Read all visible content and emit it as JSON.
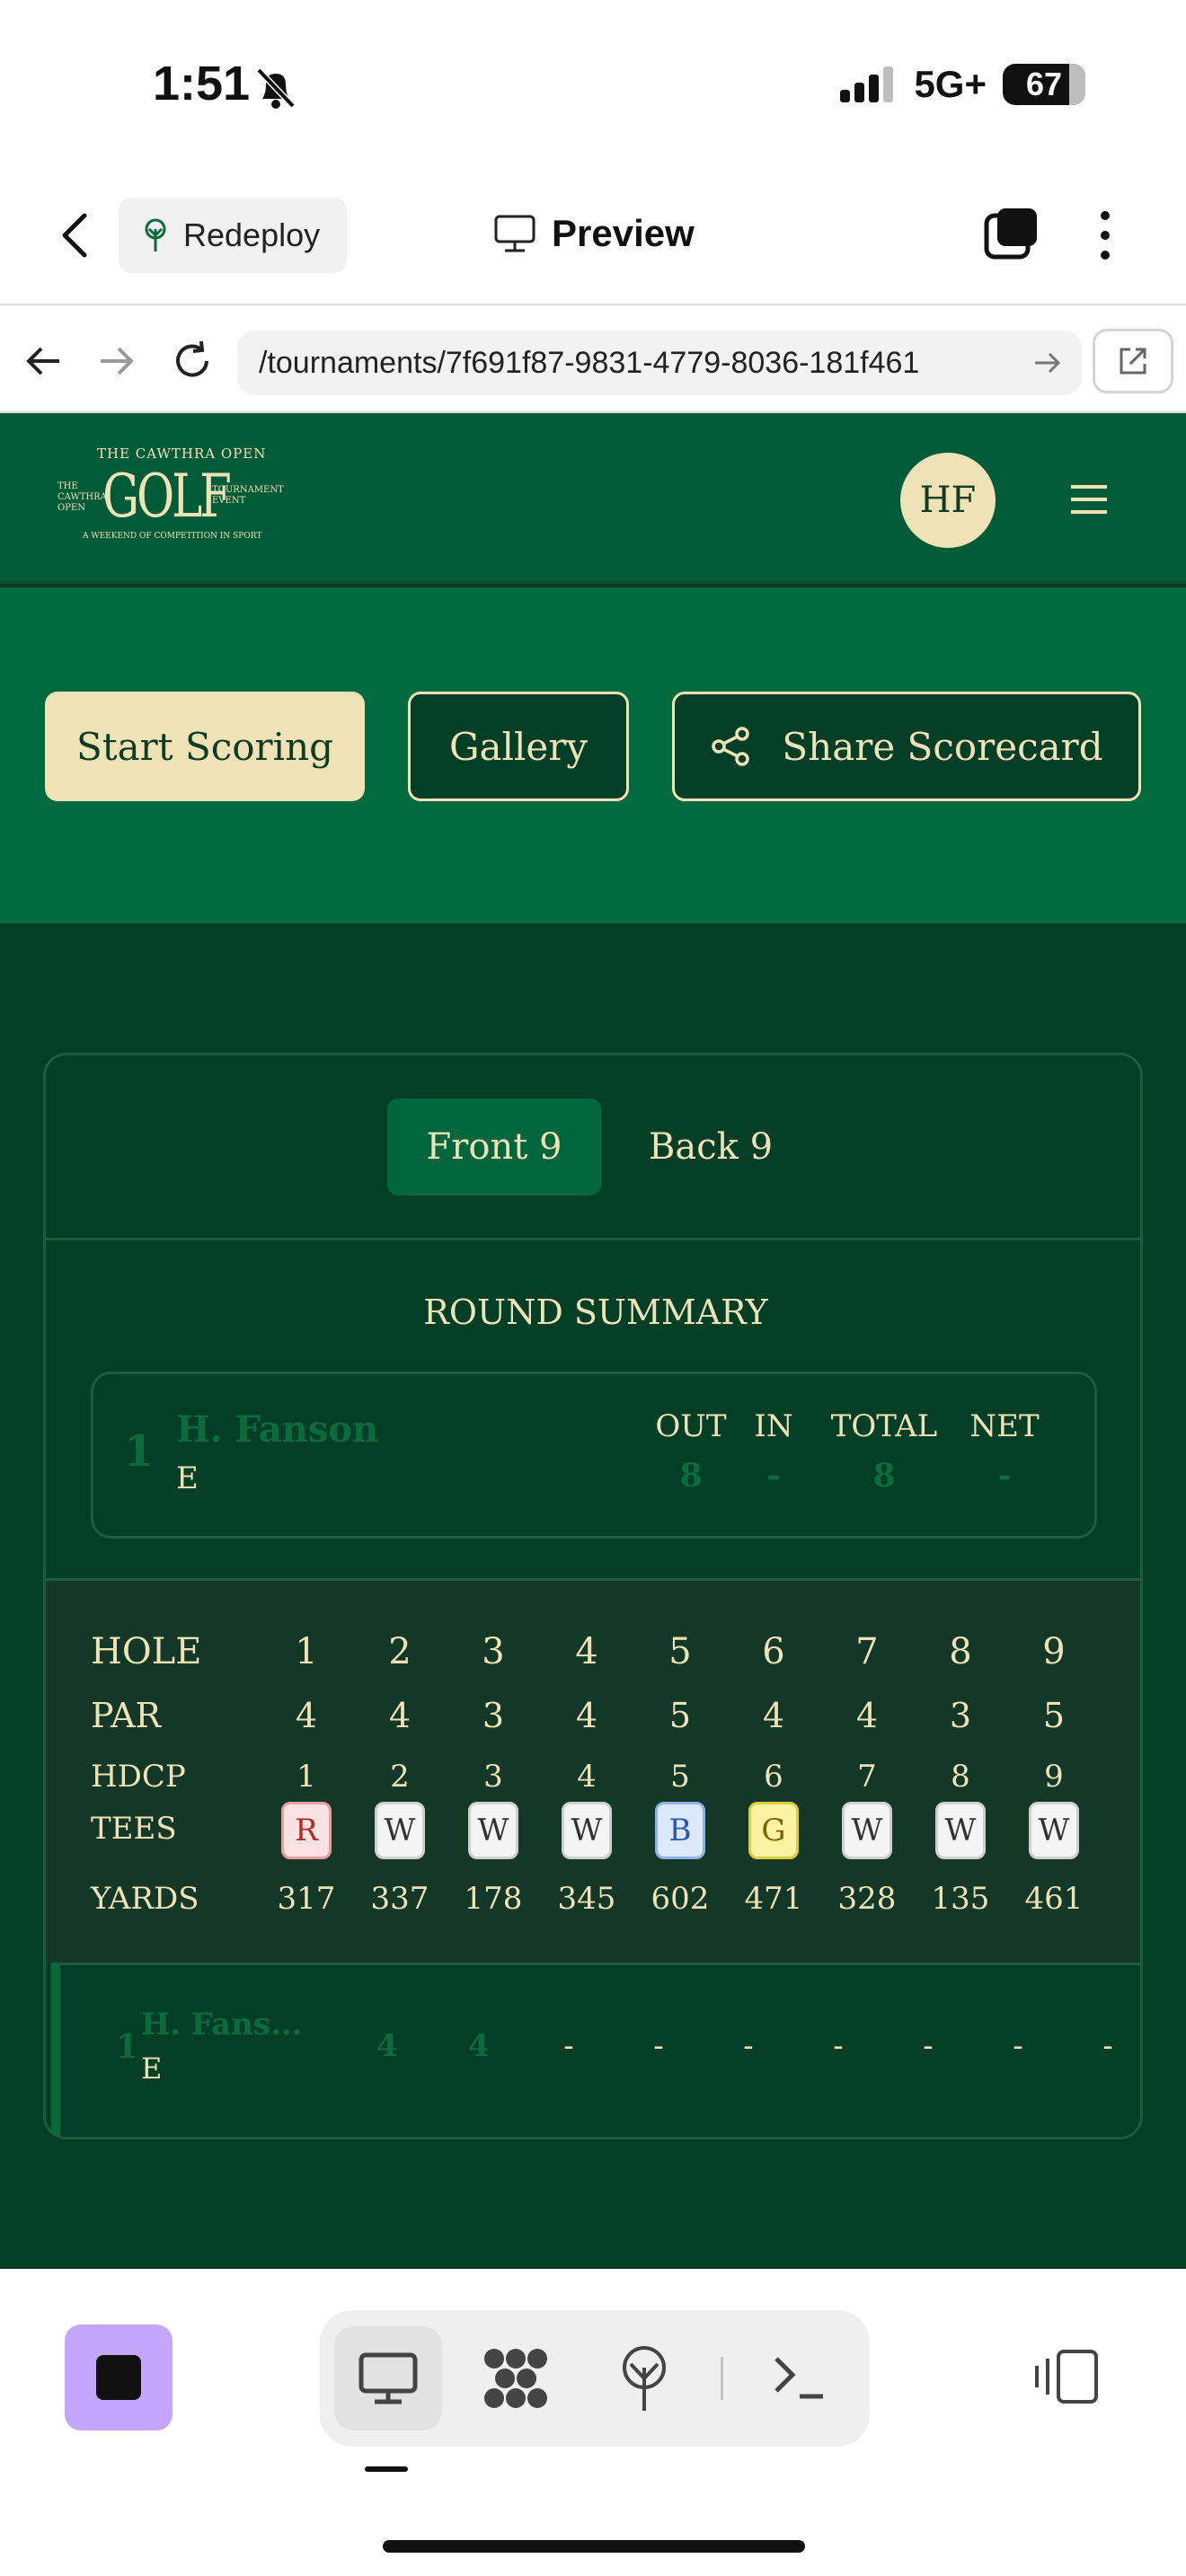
{
  "status": {
    "time": "1:51",
    "network": "5G+",
    "battery": "67"
  },
  "nav": {
    "redeploy_label": "Redeploy",
    "preview_label": "Preview"
  },
  "browser": {
    "url": "/tournaments/7f691f87-9831-4779-8036-181f461"
  },
  "site": {
    "logo": {
      "top": "THE CAWTHRA OPEN",
      "left": "THE CAWTHRA OPEN",
      "main": "GOLF",
      "right": "TOURNAMENT EVENT",
      "bottom": "A WEEKEND OF COMPETITION IN SPORT"
    },
    "avatar_initials": "HF",
    "buttons": {
      "start_scoring": "Start Scoring",
      "gallery": "Gallery",
      "share": "Share Scorecard"
    }
  },
  "scorecard": {
    "tabs": [
      "Front 9",
      "Back 9"
    ],
    "active_tab": "Front 9",
    "summary_title": "ROUND SUMMARY",
    "summary": {
      "rank": "1",
      "player": "H. Fanson",
      "to_par": "E",
      "headers": [
        "OUT",
        "IN",
        "TOTAL",
        "NET"
      ],
      "values": [
        "8",
        "-",
        "8",
        "-"
      ]
    },
    "table": {
      "labels": [
        "HOLE",
        "PAR",
        "HDCP",
        "TEES",
        "YARDS"
      ],
      "holes": [
        "1",
        "2",
        "3",
        "4",
        "5",
        "6",
        "7",
        "8",
        "9"
      ],
      "par": [
        "4",
        "4",
        "3",
        "4",
        "5",
        "4",
        "4",
        "3",
        "5"
      ],
      "hdcp": [
        "1",
        "2",
        "3",
        "4",
        "5",
        "6",
        "7",
        "8",
        "9"
      ],
      "tees": [
        "R",
        "W",
        "W",
        "W",
        "B",
        "G",
        "W",
        "W",
        "W"
      ],
      "yards": [
        "317",
        "337",
        "178",
        "345",
        "602",
        "471",
        "328",
        "135",
        "461"
      ]
    },
    "player_row": {
      "rank": "1",
      "name": "H. Fans...",
      "to_par": "E",
      "scores": [
        "4",
        "4",
        "-",
        "-",
        "-",
        "-",
        "-",
        "-",
        "-"
      ]
    }
  },
  "colors": {
    "header_green": "#005c38",
    "hero_green": "#006a3f",
    "page_green": "#033f27",
    "cream": "#efe2b6",
    "tee_red": "#fde2e2",
    "tee_white": "#f4f4f4",
    "tee_blue": "#dce8fb",
    "tee_gold": "#fbf2a3"
  },
  "icons": [
    "back-chevron-icon",
    "tree-icon",
    "monitor-icon",
    "tabs-icon",
    "more-vertical-icon",
    "arrow-left-icon",
    "arrow-right-icon",
    "reload-icon",
    "open-external-icon",
    "share-icon",
    "hamburger-icon",
    "stop-icon",
    "desktop-icon",
    "apps-icon",
    "deploy-icon",
    "terminal-icon",
    "panel-icon"
  ]
}
